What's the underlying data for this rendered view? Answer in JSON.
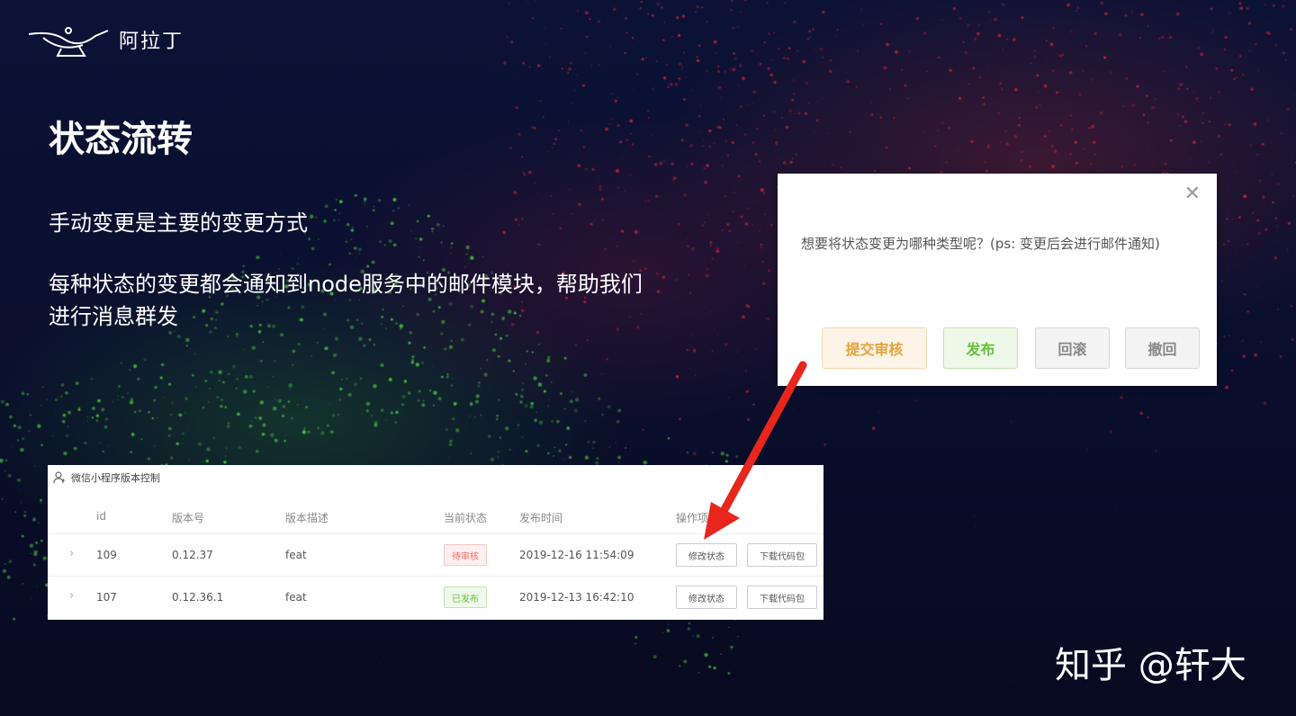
{
  "brand": {
    "name": "阿拉丁",
    "logo_icon": "magic-lamp-icon"
  },
  "slide": {
    "title": "状态流转",
    "line1": "手动变更是主要的变更方式",
    "line2": "每种状态的变更都会通知到node服务中的邮件模块，帮助我们进行消息群发"
  },
  "dialog": {
    "close_icon": "close-icon",
    "message": "想要将状态变更为哪种类型呢？(ps: 变更后会进行邮件通知)",
    "buttons": {
      "submit_review": "提交审核",
      "publish": "发布",
      "rollback": "回滚",
      "revoke": "撤回"
    }
  },
  "table": {
    "title": "微信小程序版本控制",
    "headers": {
      "id": "id",
      "version": "版本号",
      "description": "版本描述",
      "status": "当前状态",
      "publish_time": "发布时间",
      "actions": "操作项"
    },
    "rows": [
      {
        "id": "109",
        "version": "0.12.37",
        "description": "feat",
        "status": "待审核",
        "publish_time": "2019-12-16 11:54:09",
        "modify": "修改状态",
        "download": "下载代码包"
      },
      {
        "id": "107",
        "version": "0.12.36.1",
        "description": "feat",
        "status": "已发布",
        "publish_time": "2019-12-13 16:42:10",
        "modify": "修改状态",
        "download": "下载代码包"
      }
    ]
  },
  "watermark": "知乎 @轩大",
  "colors": {
    "arrow": "#e8261d",
    "submit": "#e6a23c",
    "publish": "#67c23a",
    "pending": "#f56c6c"
  }
}
